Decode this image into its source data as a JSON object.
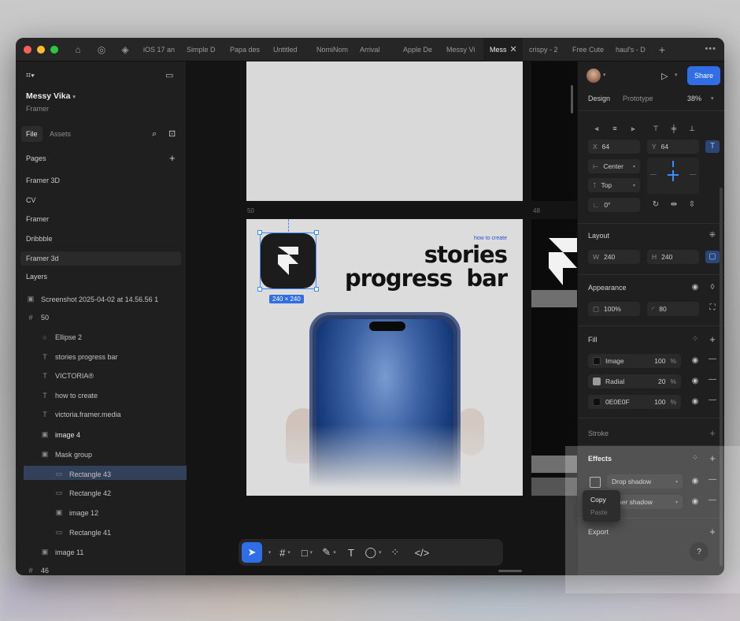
{
  "tabs": {
    "items": [
      "iOS 17 an",
      "Simple D",
      "Papa des",
      "Untitled",
      "NomiNom",
      "Arrival",
      "Apple De",
      "Messy Vi",
      "Mess",
      "crispy - 2",
      "Free Cute",
      "haul's - D"
    ],
    "active_index": 8
  },
  "left": {
    "project_name": "Messy Vika",
    "team": "Framer",
    "file_tab": "File",
    "assets_tab": "Assets",
    "pages_heading": "Pages",
    "pages": [
      "Framer 3D",
      "CV",
      "Framer",
      "Dribbble",
      "Framer 3d"
    ],
    "selected_page_index": 4,
    "layers_heading": "Layers",
    "layers": [
      {
        "name": "Screenshot 2025-04-02 at 14.56.56 1",
        "icon": "image-icon"
      },
      {
        "name": "50",
        "icon": "frame-icon"
      },
      {
        "name": "Ellipse 2",
        "icon": "ellipse-icon"
      },
      {
        "name": "stories progress bar",
        "icon": "text-icon"
      },
      {
        "name": "VICTORIA®",
        "icon": "text-icon"
      },
      {
        "name": "how to create",
        "icon": "text-icon"
      },
      {
        "name": "victoria.framer.media",
        "icon": "text-icon"
      },
      {
        "name": "image 4",
        "icon": "image-icon"
      },
      {
        "name": "Mask group",
        "icon": "image-icon"
      },
      {
        "name": "Rectangle 43",
        "icon": "rect-icon"
      },
      {
        "name": "Rectangle 42",
        "icon": "rect-icon"
      },
      {
        "name": "image 12",
        "icon": "image-icon"
      },
      {
        "name": "Rectangle 41",
        "icon": "rect-icon"
      },
      {
        "name": "image 11",
        "icon": "image-icon"
      },
      {
        "name": "46",
        "icon": "frame-icon"
      }
    ],
    "selected_layer_index": 7
  },
  "canvas": {
    "frame_label_main": "50",
    "frame_label_right": "48",
    "size_badge": "240 × 240",
    "how_to_create": "how to create",
    "headline_line1": "stories",
    "headline_line2": "progress  bar"
  },
  "right": {
    "design_tab": "Design",
    "prototype_tab": "Prototype",
    "zoom": "38%",
    "share": "Share",
    "x_label": "X",
    "x": "64",
    "y_label": "Y",
    "y": "64",
    "h_constraint": "Center",
    "v_constraint": "Top",
    "rotation": "0°",
    "layout_heading": "Layout",
    "w_label": "W",
    "w": "240",
    "h_label": "H",
    "h": "240",
    "appearance_heading": "Appearance",
    "opacity": "100%",
    "radius": "80",
    "fill_heading": "Fill",
    "fills": [
      {
        "name": "Image",
        "opacity": "100",
        "unit": "%",
        "color": "#1a1a1a"
      },
      {
        "name": "Radial",
        "opacity": "20",
        "unit": "%",
        "color": "#9a9a9a"
      },
      {
        "name": "0E0E0F",
        "opacity": "100",
        "unit": "%",
        "color": "#0e0e0f"
      }
    ],
    "stroke_heading": "Stroke",
    "effects_heading": "Effects",
    "effects": [
      "Drop shadow",
      "ner shadow"
    ],
    "export_heading": "Export",
    "help": "?"
  },
  "context_menu": {
    "copy": "Copy",
    "paste": "Paste"
  },
  "colors": {
    "accent": "#2f6ee6",
    "selection": "#3d8bff",
    "headline_accent": "#2c4fd6"
  }
}
